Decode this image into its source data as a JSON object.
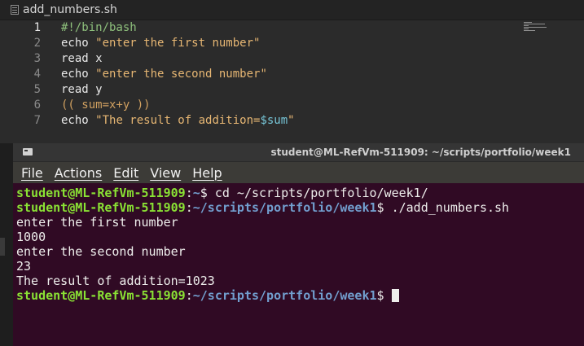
{
  "editor": {
    "tab_title": "add_numbers.sh",
    "line_numbers": [
      "1",
      "2",
      "3",
      "4",
      "5",
      "6",
      "7"
    ],
    "lines": [
      [
        {
          "t": "#!/bin/bash",
          "c": "tok-shebang"
        }
      ],
      [
        {
          "t": "echo ",
          "c": "tok-cmd"
        },
        {
          "t": "\"enter the first number\"",
          "c": "tok-str"
        }
      ],
      [
        {
          "t": "read x",
          "c": "tok-cmd"
        }
      ],
      [
        {
          "t": "echo ",
          "c": "tok-cmd"
        },
        {
          "t": "\"enter the second number\"",
          "c": "tok-str"
        }
      ],
      [
        {
          "t": "read y",
          "c": "tok-cmd"
        }
      ],
      [
        {
          "t": "(( sum=x+y ))",
          "c": "tok-paren"
        }
      ],
      [
        {
          "t": "echo ",
          "c": "tok-cmd"
        },
        {
          "t": "\"The result of addition=",
          "c": "tok-str"
        },
        {
          "t": "$sum",
          "c": "tok-var"
        },
        {
          "t": "\"",
          "c": "tok-str"
        }
      ]
    ]
  },
  "terminal": {
    "title": "student@ML-RefVm-511909: ~/scripts/portfolio/week1",
    "menu": [
      "File",
      "Actions",
      "Edit",
      "View",
      "Help"
    ],
    "lines": [
      [
        {
          "t": "student@ML-RefVm-511909",
          "c": "p-user"
        },
        {
          "t": ":",
          "c": "p-plain"
        },
        {
          "t": "~",
          "c": "p-path"
        },
        {
          "t": "$ cd ~/scripts/portfolio/week1/",
          "c": "p-plain"
        }
      ],
      [
        {
          "t": "student@ML-RefVm-511909",
          "c": "p-user"
        },
        {
          "t": ":",
          "c": "p-plain"
        },
        {
          "t": "~/scripts/portfolio/week1",
          "c": "p-path"
        },
        {
          "t": "$ ./add_numbers.sh",
          "c": "p-plain"
        }
      ],
      [
        {
          "t": "enter the first number",
          "c": "p-plain"
        }
      ],
      [
        {
          "t": "1000",
          "c": "p-plain"
        }
      ],
      [
        {
          "t": "enter the second number",
          "c": "p-plain"
        }
      ],
      [
        {
          "t": "23",
          "c": "p-plain"
        }
      ],
      [
        {
          "t": "The result of addition=1023",
          "c": "p-plain"
        }
      ],
      [
        {
          "t": "student@ML-RefVm-511909",
          "c": "p-user"
        },
        {
          "t": ":",
          "c": "p-plain"
        },
        {
          "t": "~/scripts/portfolio/week1",
          "c": "p-path"
        },
        {
          "t": "$ ",
          "c": "p-plain"
        }
      ]
    ]
  }
}
